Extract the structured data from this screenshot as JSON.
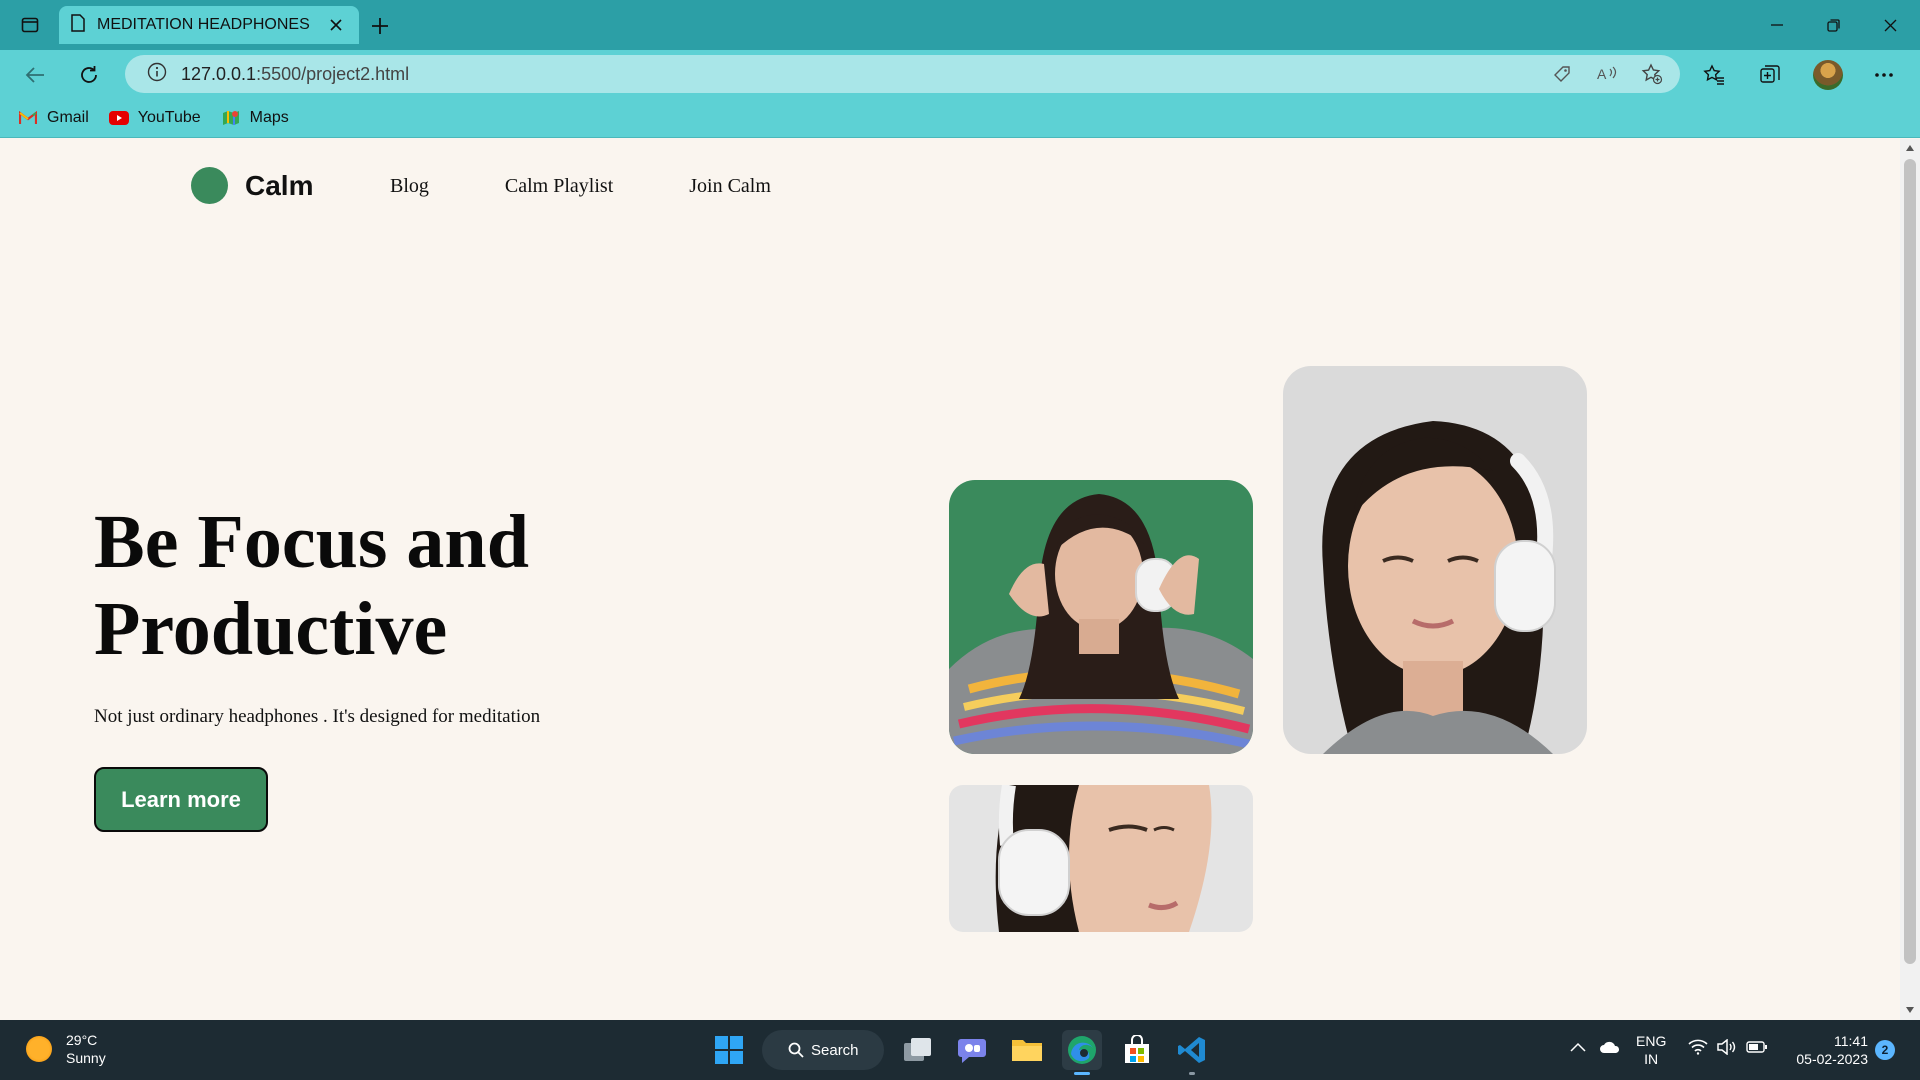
{
  "browser": {
    "tab_title": "MEDITATION HEADPHONES | H",
    "url_host": "127.0.0.1",
    "url_rest": ":5500/project2.html",
    "bookmarks": [
      {
        "label": "Gmail",
        "icon": "gmail-icon"
      },
      {
        "label": "YouTube",
        "icon": "youtube-icon"
      },
      {
        "label": "Maps",
        "icon": "maps-icon"
      }
    ]
  },
  "site": {
    "logo_text": "Calm",
    "nav": [
      "Blog",
      "Calm Playlist",
      "Join Calm"
    ],
    "hero_title_line1": "Be Focus and",
    "hero_title_line2": "Productive",
    "hero_subtitle": "Not just ordinary headphones . It's designed for meditation",
    "cta_label": "Learn more",
    "brand_color": "#3a8a5c"
  },
  "taskbar": {
    "temperature": "29°C",
    "condition": "Sunny",
    "search_label": "Search",
    "lang_line1": "ENG",
    "lang_line2": "IN",
    "time": "11:41",
    "date": "05-02-2023",
    "notification_count": "2"
  }
}
